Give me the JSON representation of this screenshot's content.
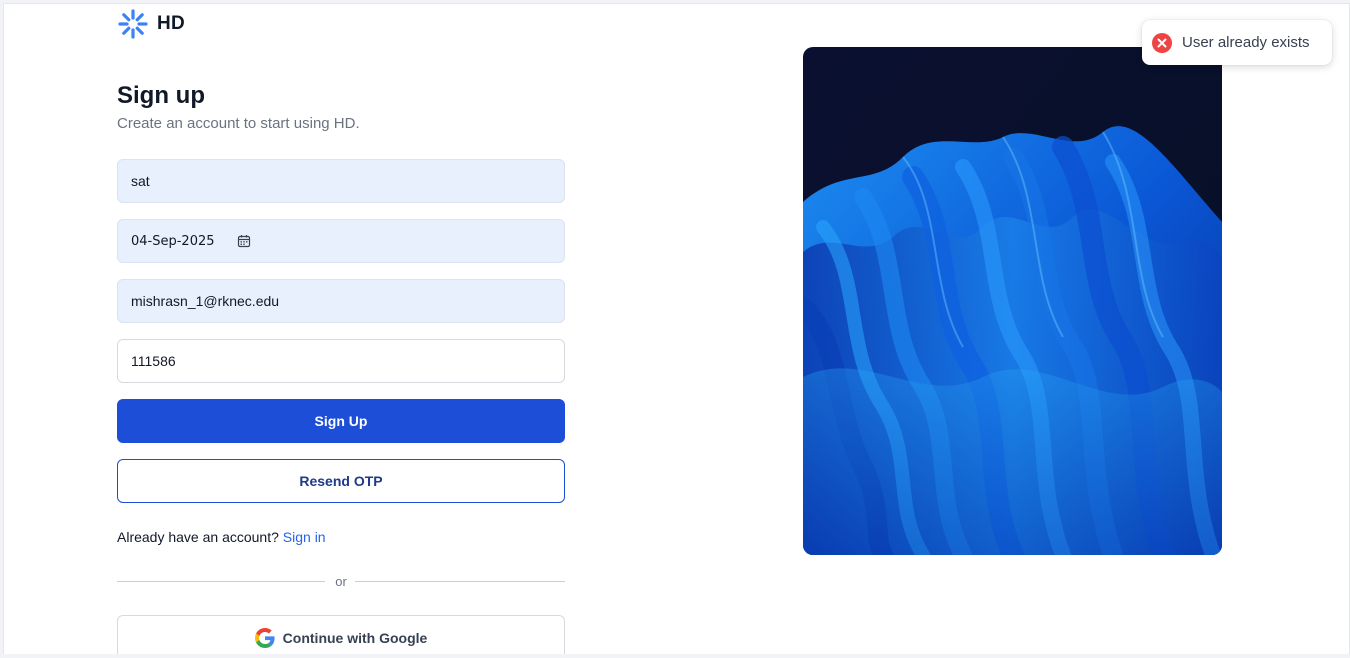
{
  "brand": {
    "name": "HD",
    "icon": "sunburst-logo-icon",
    "color": "#3b82f6"
  },
  "heading": {
    "title": "Sign up",
    "subtitle": "Create an account to start using HD."
  },
  "form": {
    "name_value": "sat",
    "dob_value": "04-Sep-2025",
    "email_value": "mishrasn_1@rknec.edu",
    "otp_value": "111586",
    "signup_label": "Sign Up",
    "resend_label": "Resend OTP",
    "account_prompt": "Already have an account?",
    "signin_label": "Sign in",
    "divider_label": "or",
    "google_label": "Continue with Google"
  },
  "toast": {
    "message": "User already exists",
    "icon": "error-circle-icon",
    "color": "#ef4444"
  },
  "hero": {
    "alt": "abstract-blue-waves-image"
  },
  "colors": {
    "primary": "#1d4ed8",
    "link": "#2563eb",
    "filled_input": "#e8effd"
  }
}
